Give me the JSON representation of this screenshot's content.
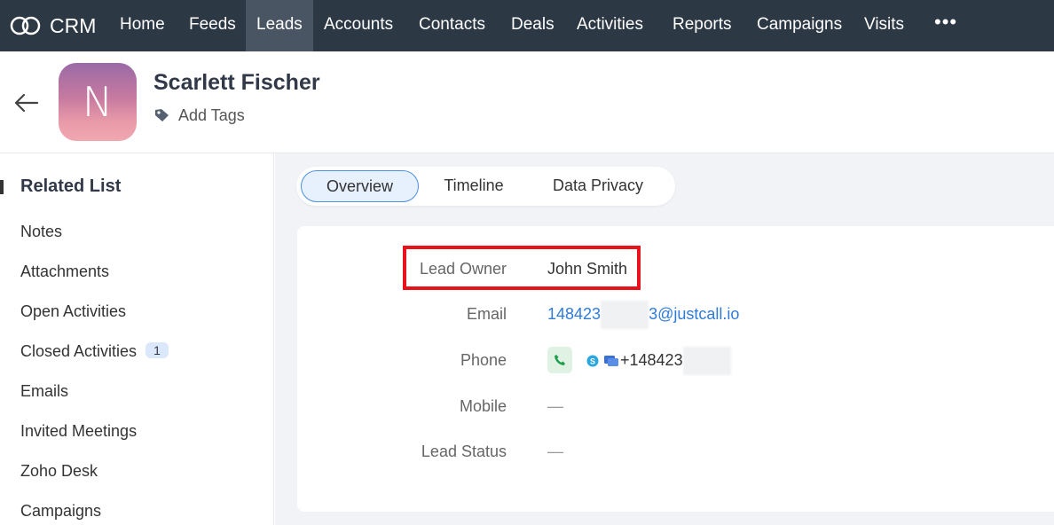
{
  "app": {
    "logo_text": "CRM",
    "nav_items": [
      "Home",
      "Feeds",
      "Leads",
      "Accounts",
      "Contacts",
      "Deals",
      "Activities",
      "Reports",
      "Campaigns",
      "Visits"
    ],
    "active_nav": "Leads",
    "more_label": "•••"
  },
  "record": {
    "avatar_initial": "N",
    "name": "Scarlett Fischer",
    "add_tags_label": "Add Tags"
  },
  "sidebar": {
    "title": "Related List",
    "items": [
      "Notes",
      "Attachments",
      "Open Activities",
      "Closed Activities",
      "Emails",
      "Invited Meetings",
      "Zoho Desk",
      "Campaigns"
    ],
    "closed_activities_count": "1"
  },
  "tabs": [
    "Overview",
    "Timeline",
    "Data Privacy"
  ],
  "active_tab": "Overview",
  "fields": {
    "lead_owner_label": "Lead Owner",
    "lead_owner_value": "John Smith",
    "email_label": "Email",
    "email_prefix": "148423",
    "email_suffix": "3@justcall.io",
    "phone_label": "Phone",
    "phone_value": "+148423",
    "mobile_label": "Mobile",
    "mobile_value": "—",
    "lead_status_label": "Lead Status",
    "lead_status_value": "—"
  },
  "colors": {
    "nav_bg": "#2d3845",
    "active_nav_bg": "#4a5563",
    "link": "#2f7bd8",
    "highlight_border": "#e8121a",
    "tab_active_border": "#4c8fe0"
  },
  "icons": {
    "logo": "crm-logo-icon",
    "back": "arrow-left-icon",
    "tag": "tag-icon",
    "call": "phone-call-icon",
    "skype": "skype-icon",
    "chat": "chat-icon"
  }
}
